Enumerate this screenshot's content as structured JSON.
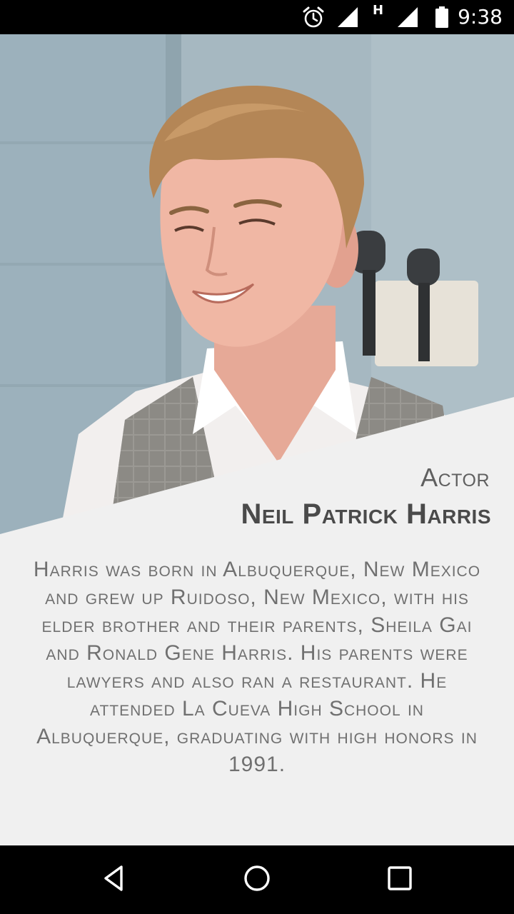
{
  "status_bar": {
    "time": "9:38",
    "network_type": "H",
    "icons": [
      "alarm-icon",
      "signal-icon",
      "signal-icon-2",
      "battery-icon"
    ]
  },
  "hero": {
    "image_semantic": "portrait-photo"
  },
  "profile": {
    "role": "Actor",
    "name": "Neil Patrick Harris",
    "bio": "Harris was born in Albuquerque, New Mexico and grew up Ruidoso, New Mexico, with his elder brother and their parents, Sheila Gai and Ronald Gene Harris. His parents were lawyers and also ran a restaurant. He attended La Cueva High School in Albuquerque, graduating with high honors in 1991."
  },
  "nav_bar": {
    "buttons": [
      "back-icon",
      "home-icon",
      "recents-icon"
    ]
  },
  "colors": {
    "panel": "#f0f0f0",
    "text_dark": "#4a4a4a",
    "text_mid": "#606060",
    "text_body": "#707070",
    "bar": "#000000"
  }
}
